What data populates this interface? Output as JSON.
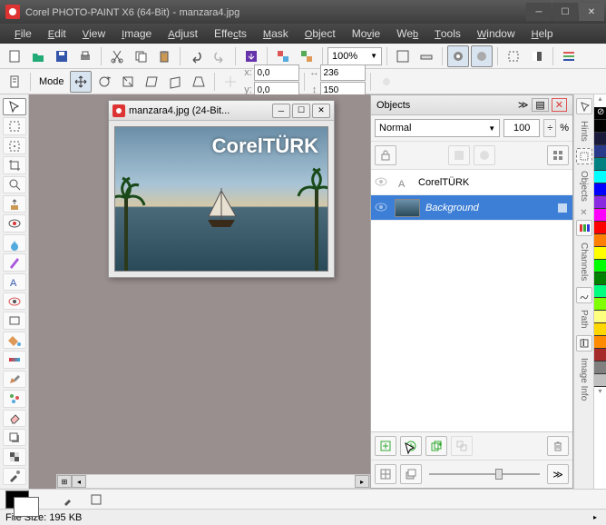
{
  "titlebar": {
    "app": "Corel PHOTO-PAINT X6 (64-Bit)",
    "doc": "manzara4.jpg"
  },
  "menu": [
    "File",
    "Edit",
    "View",
    "Image",
    "Adjust",
    "Effects",
    "Mask",
    "Object",
    "Movie",
    "Web",
    "Tools",
    "Window",
    "Help"
  ],
  "zoom": "100%",
  "coords": {
    "x1": "0,0",
    "y1": "0,0",
    "x2": "236",
    "y2": "150"
  },
  "toolrow2_label": "Mode",
  "docwin": {
    "title": "manzara4.jpg (24-Bit...",
    "watermark": "CorelTÜRK"
  },
  "objects": {
    "panel_title": "Objects",
    "blend": "Normal",
    "opacity": "100",
    "pct": "%",
    "layers": [
      {
        "name": "CorelTÜRK",
        "sel": false,
        "text": true
      },
      {
        "name": "Background",
        "sel": true,
        "text": false
      }
    ]
  },
  "right_tabs": [
    "Hints",
    "Objects",
    "Channels",
    "Path",
    "Image Info"
  ],
  "status": {
    "label": "File Size:",
    "value": "195 KB"
  },
  "swatches": [
    "#000000",
    "#ffffff",
    "#1a2a6c",
    "#2d5aa8",
    "#ff0000",
    "#ff7f00",
    "#ffff00",
    "#00ff00",
    "#00ffff",
    "#0000ff",
    "#ff00ff",
    "#808080"
  ]
}
